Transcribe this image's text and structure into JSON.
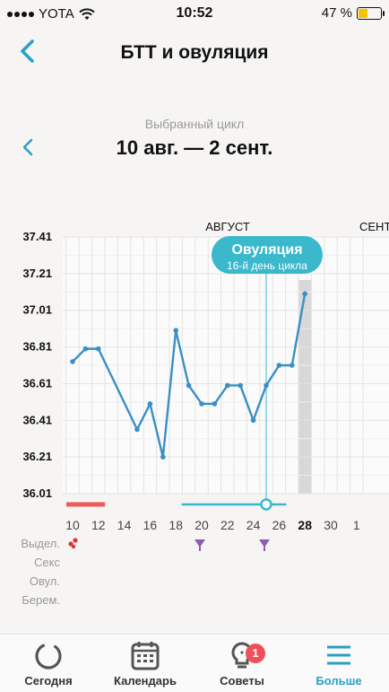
{
  "status_bar": {
    "carrier": "YOTA",
    "time": "10:52",
    "battery": "47 %",
    "battery_level": 0.47
  },
  "header": {
    "title": "БТТ и овуляция"
  },
  "cycle": {
    "label": "Выбранный цикл",
    "range": "10 авг. — 2 сент."
  },
  "chart_data": {
    "type": "line",
    "x": [
      10,
      11,
      12,
      13,
      14,
      15,
      16,
      17,
      18,
      19,
      20,
      21,
      22,
      23,
      24,
      25,
      26,
      27,
      28,
      29,
      30,
      31,
      32
    ],
    "x_ticks": [
      "10",
      "12",
      "14",
      "16",
      "18",
      "20",
      "22",
      "24",
      "26",
      "28",
      "30",
      "1"
    ],
    "month_labels": [
      "АВГУСТ",
      "СЕНТ"
    ],
    "y_ticks": [
      "37.41",
      "37.21",
      "37.01",
      "36.81",
      "36.61",
      "36.41",
      "36.21",
      "36.01"
    ],
    "ylim": [
      36.01,
      37.41
    ],
    "series": [
      {
        "values": [
          {
            "day": 10,
            "t": 36.73
          },
          {
            "day": 11,
            "t": 36.8
          },
          {
            "day": 12,
            "t": 36.8
          },
          {
            "day": 15,
            "t": 36.36
          },
          {
            "day": 16,
            "t": 36.5
          },
          {
            "day": 17,
            "t": 36.21
          },
          {
            "day": 18,
            "t": 36.9
          },
          {
            "day": 19,
            "t": 36.6
          },
          {
            "day": 20,
            "t": 36.5
          },
          {
            "day": 21,
            "t": 36.5
          },
          {
            "day": 22,
            "t": 36.6
          },
          {
            "day": 23,
            "t": 36.6
          },
          {
            "day": 24,
            "t": 36.41
          },
          {
            "day": 25,
            "t": 36.6
          },
          {
            "day": 26,
            "t": 36.71
          },
          {
            "day": 27,
            "t": 36.71
          },
          {
            "day": 28,
            "t": 37.1
          }
        ]
      }
    ],
    "current_day": "28",
    "ovulation_day": 25,
    "ovulation_tooltip": {
      "title": "Овуляция",
      "subtitle": "16-й день цикла"
    },
    "period_days": [
      10,
      13
    ],
    "fertile_days": [
      19,
      26
    ],
    "grid": true
  },
  "rows": {
    "discharge": "Выдел.",
    "sex": "Секс",
    "ovulation": "Овул.",
    "pregnancy": "Берем."
  },
  "row_markers": {
    "discharge_days": [
      10
    ],
    "ovulation_days": [
      20,
      25
    ]
  },
  "colors": {
    "accent": "#2aa0c6",
    "line": "#3a8fc5",
    "period": "#f05a5a",
    "tooltip": "#3ab8cc",
    "drop": "#e0353c",
    "ovulation_mark": "#8a5fb0"
  },
  "tabs": [
    {
      "label": "Сегодня",
      "icon": "ring-icon"
    },
    {
      "label": "Календарь",
      "icon": "calendar-icon"
    },
    {
      "label": "Советы",
      "icon": "lightbulb-icon",
      "badge": "1"
    },
    {
      "label": "Больше",
      "icon": "menu-icon",
      "active": true
    }
  ]
}
